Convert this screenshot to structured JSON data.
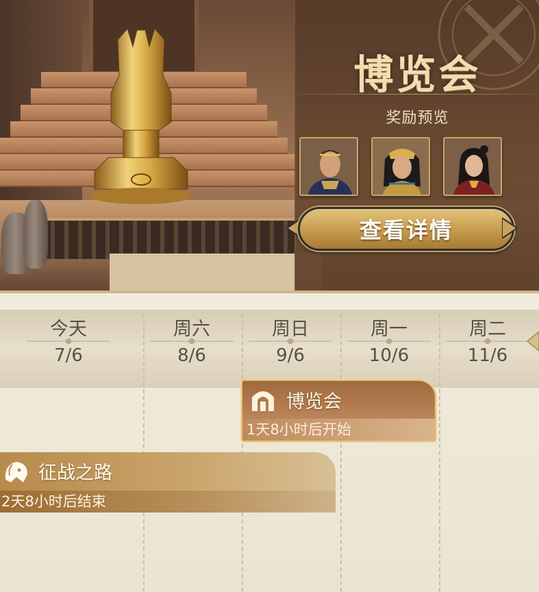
{
  "banner": {
    "title": "博览会",
    "rewards_label": "奖励预览",
    "rewards": [
      {
        "icon": "hero-commander-portrait"
      },
      {
        "icon": "hero-pharaoh-queen-portrait"
      },
      {
        "icon": "hero-warrior-woman-portrait"
      }
    ],
    "details_button": "查看详情"
  },
  "calendar": {
    "days": [
      {
        "name": "今天",
        "date": "7/6"
      },
      {
        "name": "周六",
        "date": "8/6"
      },
      {
        "name": "周日",
        "date": "9/6"
      },
      {
        "name": "周一",
        "date": "10/6"
      },
      {
        "name": "周二",
        "date": "11/6"
      }
    ]
  },
  "events": {
    "expo": {
      "title": "博览会",
      "status": "1天8小时后开始",
      "icon": "arch-gate-icon"
    },
    "war_path": {
      "title": "征战之路",
      "status": "2天8小时后结束",
      "icon": "lion-head-icon"
    }
  },
  "colors": {
    "gold": "#c9a557",
    "panel_brown": "#5f4230",
    "schedule_bg": "#ece5d4",
    "expo_event": "#b27a4e",
    "war_event": "#c29c60"
  }
}
